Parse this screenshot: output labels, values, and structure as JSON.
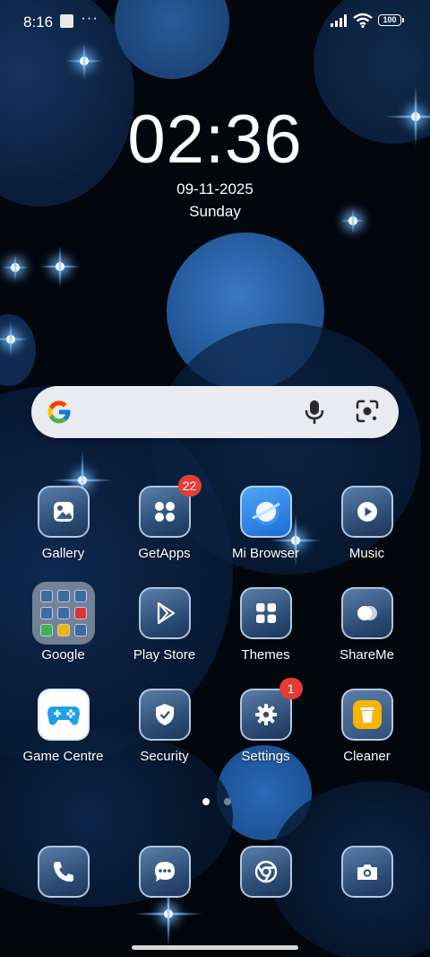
{
  "status_bar": {
    "time": "8:16",
    "dots": "···",
    "battery": "100"
  },
  "clock": {
    "time": "02:36",
    "date": "09-11-2025",
    "weekday": "Sunday"
  },
  "search": {
    "engine_icon": "google-g-icon",
    "mic_icon": "mic-icon",
    "lens_icon": "lens-icon"
  },
  "apps": [
    {
      "label": "Gallery",
      "icon": "gallery-icon"
    },
    {
      "label": "GetApps",
      "icon": "getapps-icon",
      "badge": "22"
    },
    {
      "label": "Mi Browser",
      "icon": "browser-icon"
    },
    {
      "label": "Music",
      "icon": "music-icon"
    },
    {
      "label": "Google",
      "icon": "folder-icon"
    },
    {
      "label": "Play Store",
      "icon": "play-store-icon"
    },
    {
      "label": "Themes",
      "icon": "themes-icon"
    },
    {
      "label": "ShareMe",
      "icon": "shareme-icon"
    },
    {
      "label": "Game Centre",
      "icon": "game-centre-icon"
    },
    {
      "label": "Security",
      "icon": "security-icon"
    },
    {
      "label": "Settings",
      "icon": "settings-icon",
      "badge": "1"
    },
    {
      "label": "Cleaner",
      "icon": "cleaner-icon"
    }
  ],
  "dock": [
    {
      "icon": "phone-icon"
    },
    {
      "icon": "messages-icon"
    },
    {
      "icon": "chrome-icon"
    },
    {
      "icon": "camera-icon"
    }
  ],
  "pages": {
    "count": 2,
    "current": 1
  }
}
